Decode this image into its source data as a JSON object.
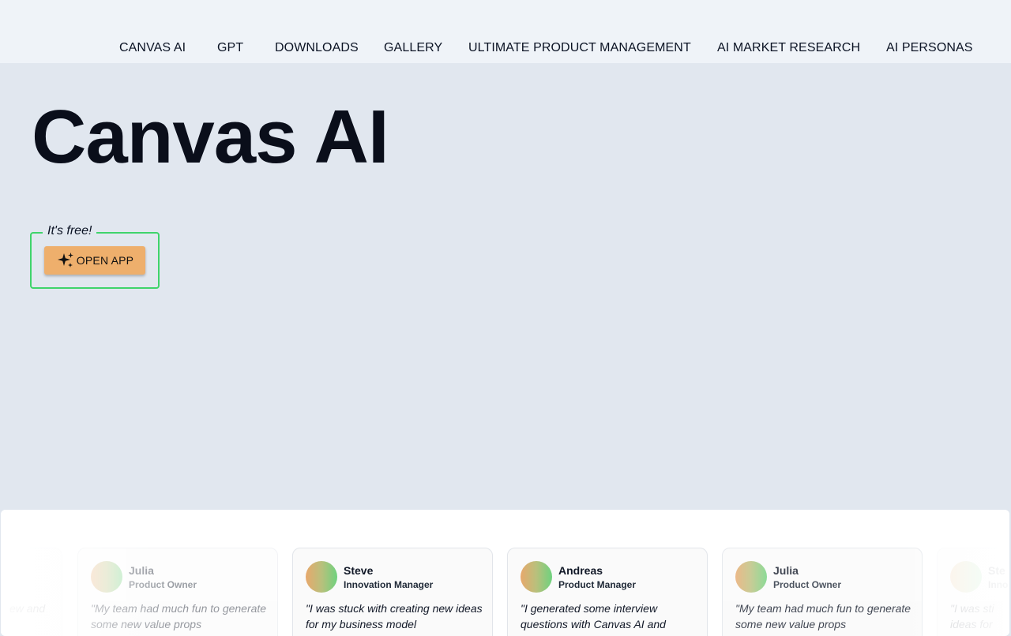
{
  "nav": {
    "items": [
      {
        "label": "CANVAS AI"
      },
      {
        "label": "GPT"
      },
      {
        "label": "DOWNLOADS"
      },
      {
        "label": "GALLERY"
      },
      {
        "label": "ULTIMATE PRODUCT MANAGEMENT"
      },
      {
        "label": "AI MARKET RESEARCH"
      },
      {
        "label": "AI PERSONAS"
      }
    ]
  },
  "hero": {
    "title": "Canvas AI",
    "free_label": "It's free!",
    "open_button": "OPEN APP",
    "open_button_icon": "sparkles-icon"
  },
  "testimonials": [
    {
      "name": "",
      "role": "",
      "quote": "ew\nand"
    },
    {
      "name": "Julia",
      "role": "Product Owner",
      "quote": "\"My team had much fun to generate some new value props"
    },
    {
      "name": "Steve",
      "role": "Innovation Manager",
      "quote": "\"I was stuck with creating new ideas for my business model"
    },
    {
      "name": "Andreas",
      "role": "Product Manager",
      "quote": "\"I generated some interview questions with Canvas AI and"
    },
    {
      "name": "Julia",
      "role": "Product Owner",
      "quote": "\"My team had much fun to generate some new value props"
    },
    {
      "name": "Ste",
      "role": "Inno",
      "quote": "\"I was sti\nideas for"
    }
  ],
  "colors": {
    "accent_button": "#eeaf6c",
    "free_border": "#3fd46b",
    "page_bg": "#e1e7ef"
  }
}
